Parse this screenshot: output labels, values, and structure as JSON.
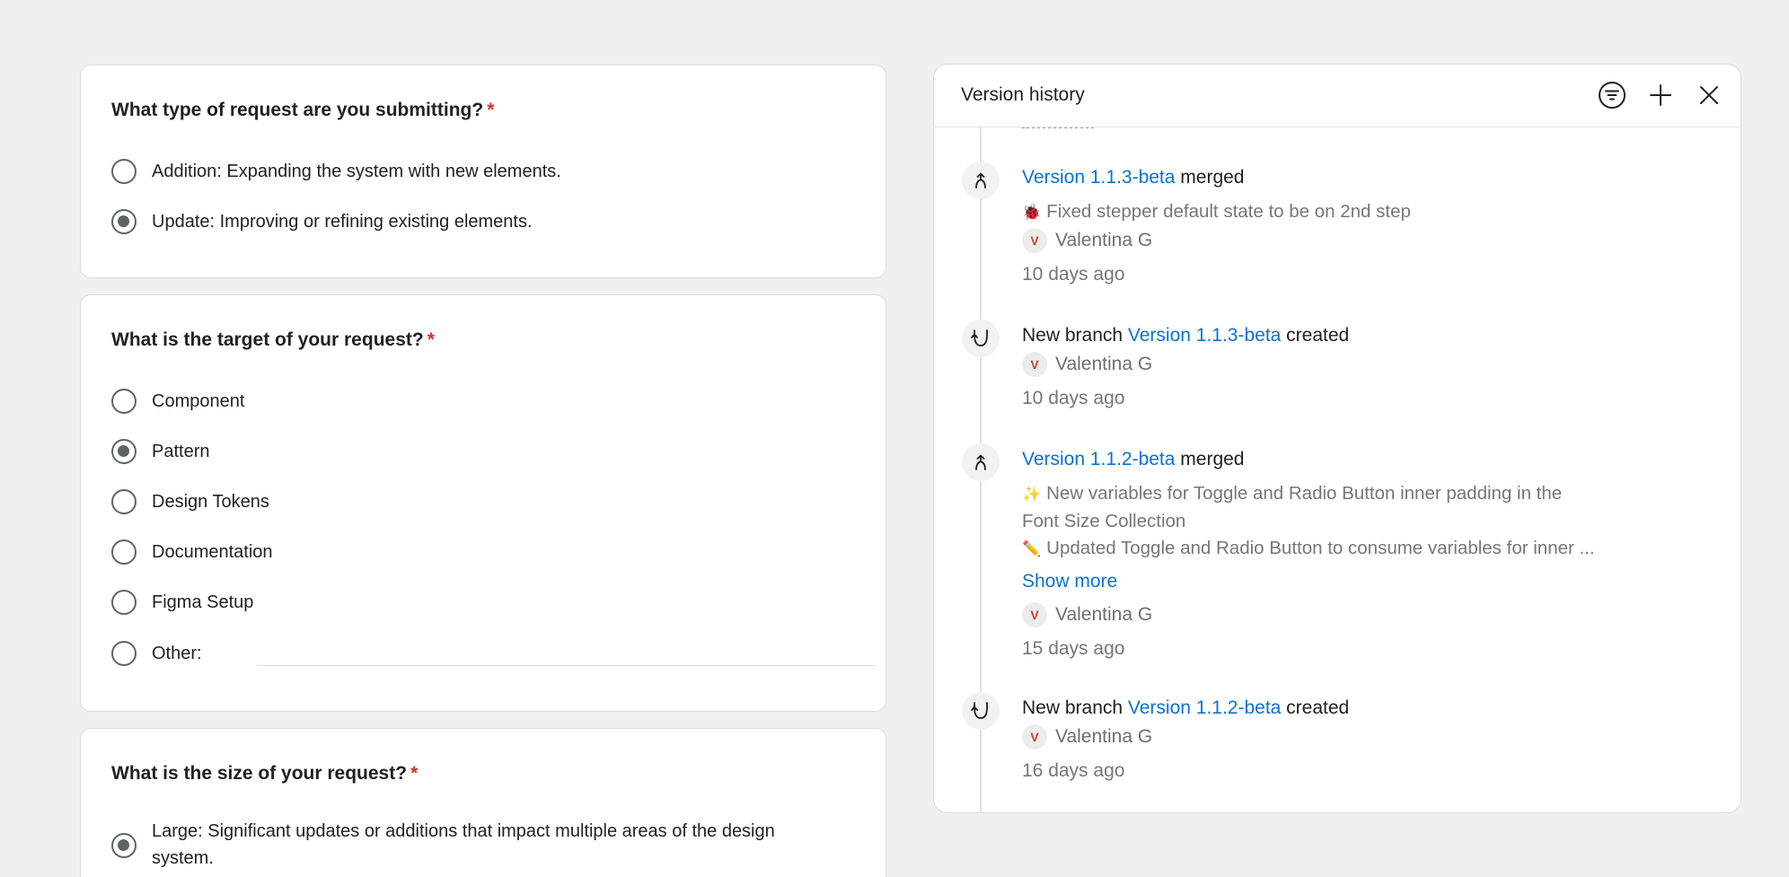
{
  "form": {
    "q1": {
      "title": "What type of request are you submitting?",
      "required": "*",
      "options": [
        {
          "label": "Addition: Expanding the system with new elements.",
          "checked": false
        },
        {
          "label": "Update: Improving or refining existing elements.",
          "checked": true
        }
      ]
    },
    "q2": {
      "title": "What is the target of your request?",
      "required": "*",
      "options": [
        {
          "label": "Component",
          "checked": false
        },
        {
          "label": "Pattern",
          "checked": true
        },
        {
          "label": "Design Tokens",
          "checked": false
        },
        {
          "label": "Documentation",
          "checked": false
        },
        {
          "label": "Figma Setup",
          "checked": false
        },
        {
          "label": "Other:",
          "checked": false
        }
      ],
      "other_value": ""
    },
    "q3": {
      "title": "What is the size of your request?",
      "required": "*",
      "options": [
        {
          "label": "Large: Significant updates or additions that impact multiple areas of the design system.",
          "checked": true
        }
      ]
    }
  },
  "version_history": {
    "title": "Version history",
    "icons": {
      "filter": "filter-icon",
      "add": "plus-icon",
      "close": "close-icon"
    },
    "entries": [
      {
        "type": "merge",
        "link_text": "Version 1.1.3-beta",
        "suffix": " merged",
        "notes": [
          {
            "emoji": "🐞",
            "text": "Fixed stepper default state to be on 2nd step"
          }
        ],
        "author_initial": "V",
        "author": "Valentina G",
        "time": "10 days ago"
      },
      {
        "type": "branch",
        "prefix": "New branch ",
        "link_text": "Version 1.1.3-beta",
        "suffix": " created",
        "author_initial": "V",
        "author": "Valentina G",
        "time": "10 days ago"
      },
      {
        "type": "merge",
        "link_text": "Version 1.1.2-beta",
        "suffix": " merged",
        "notes": [
          {
            "emoji": "✨",
            "text": "New variables for Toggle and Radio Button inner padding in the"
          },
          {
            "emoji": "",
            "text": "Font Size Collection"
          },
          {
            "emoji": "✏️",
            "text": "Updated Toggle and Radio Button to consume variables for inner ..."
          }
        ],
        "show_more": "Show more",
        "author_initial": "V",
        "author": "Valentina G",
        "time": "15 days ago"
      },
      {
        "type": "branch",
        "prefix": "New branch ",
        "link_text": "Version 1.1.2-beta",
        "suffix": " created",
        "author_initial": "V",
        "author": "Valentina G",
        "time": "16 days ago"
      }
    ]
  },
  "colors": {
    "link": "#0a72d1",
    "required": "#d93025",
    "avatar_text": "#c9432b"
  }
}
